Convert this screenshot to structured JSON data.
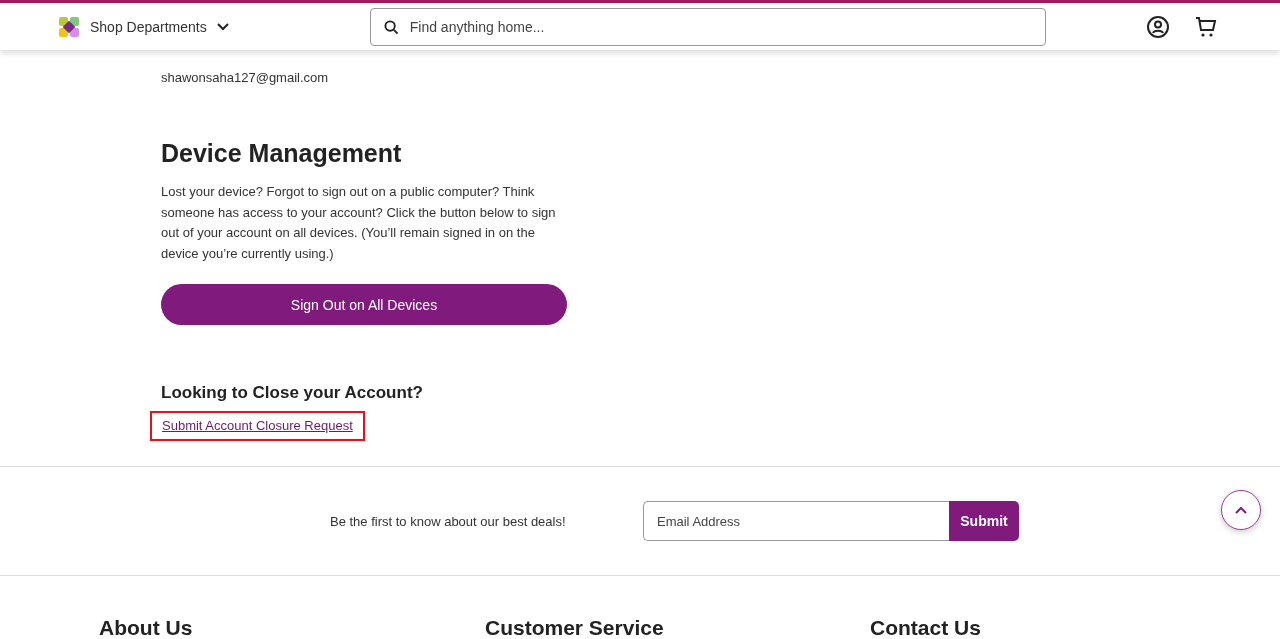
{
  "header": {
    "departments": "Shop Departments",
    "search": {
      "placeholder": "Find anything home..."
    }
  },
  "account": {
    "email": "shawonsaha127@gmail.com"
  },
  "device_management": {
    "title": "Device Management",
    "text": "Lost your device? Forgot to sign out on a public computer? Think someone has access to your account? Click the button below to sign out of your account on all devices. (You’ll remain signed in on the device you’re currently using.)",
    "button": "Sign Out on All Devices"
  },
  "close_account": {
    "title": "Looking to Close your Account?",
    "link": "Submit Account Closure Request",
    "highlighted": true
  },
  "newsletter": {
    "text": "Be the first to know about our best deals!",
    "placeholder": "Email Address",
    "button": "Submit"
  },
  "footer": {
    "headings": [
      "About Us",
      "Customer Service",
      "Contact Us"
    ]
  }
}
